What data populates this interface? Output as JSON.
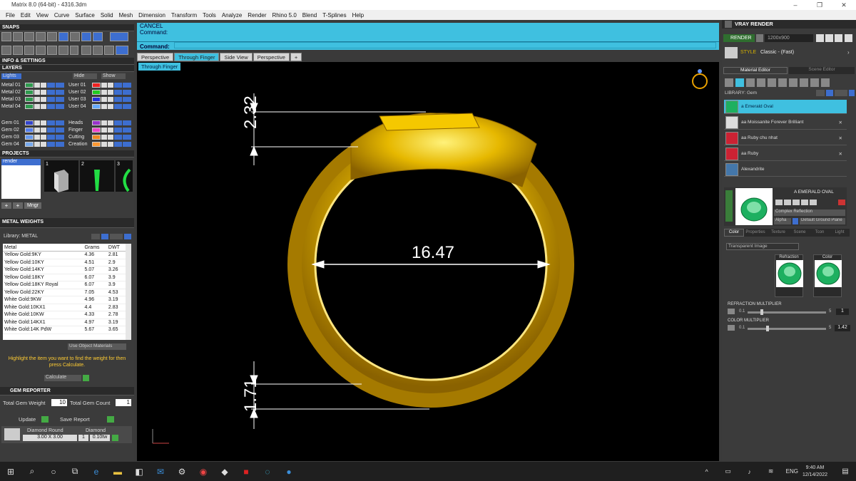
{
  "window": {
    "title": "Matrix 8.0 (64-bit) - 4316.3dm",
    "controls": [
      "–",
      "❐",
      "✕"
    ]
  },
  "menu": [
    "File",
    "Edit",
    "View",
    "Curve",
    "Surface",
    "Solid",
    "Mesh",
    "Dimension",
    "Transform",
    "Tools",
    "Analyze",
    "Render",
    "Rhino 5.0",
    "Blend",
    "T-Splines",
    "Help"
  ],
  "left": {
    "snaps": "SNAPS",
    "info": "INFO & SETTINGS",
    "layers_title": "LAYERS",
    "lights": "Lights",
    "hide": "Hide",
    "show": "Show",
    "layers_left": [
      {
        "name": "Metal 01",
        "color": "#2e9a4e"
      },
      {
        "name": "Metal 02",
        "color": "#2e9a4e"
      },
      {
        "name": "Metal 03",
        "color": "#2e9a4e"
      },
      {
        "name": "Metal 04",
        "color": "#2e9a4e"
      },
      {
        "name": "Gem 01",
        "color": "#3344cc"
      },
      {
        "name": "Gem 02",
        "color": "#5580ee"
      },
      {
        "name": "Gem 03",
        "color": "#6699ee"
      },
      {
        "name": "Gem 04",
        "color": "#77aaee"
      }
    ],
    "layers_right": [
      {
        "name": "User 01",
        "color": "#ee2222"
      },
      {
        "name": "User 02",
        "color": "#22cc22"
      },
      {
        "name": "User 03",
        "color": "#2233dd"
      },
      {
        "name": "User 04",
        "color": "#66aaff"
      },
      {
        "name": "Heads",
        "color": "#9933cc"
      },
      {
        "name": "Finger",
        "color": "#ee44cc"
      },
      {
        "name": "Cutting",
        "color": "#ee8822"
      },
      {
        "name": "Creation",
        "color": "#ff9933"
      }
    ],
    "projects": "PROJECTS",
    "project_name": "render",
    "thumb_numbers": [
      "1",
      "2",
      "3"
    ],
    "mngr": "Mngr",
    "metal_weights": "METAL WEIGHTS",
    "library": "Library: METAL",
    "columns": [
      "Metal",
      "Grams",
      "DWT"
    ],
    "metals": [
      [
        "Yellow Gold:9KY",
        "4.36",
        "2.81"
      ],
      [
        "Yellow Gold:10KY",
        "4.51",
        "2.9"
      ],
      [
        "Yellow Gold:14KY",
        "5.07",
        "3.26"
      ],
      [
        "Yellow Gold:18KY",
        "6.07",
        "3.9"
      ],
      [
        "Yellow Gold:18KY Royal",
        "6.07",
        "3.9"
      ],
      [
        "Yellow Gold:22KY",
        "7.05",
        "4.53"
      ],
      [
        "White Gold:9KW",
        "4.96",
        "3.19"
      ],
      [
        "White Gold:10KX1",
        "4.4",
        "2.83"
      ],
      [
        "White Gold:10KW",
        "4.33",
        "2.78"
      ],
      [
        "White Gold:14KX1",
        "4.97",
        "3.19"
      ],
      [
        "White Gold:14K PdW",
        "5.67",
        "3.65"
      ]
    ],
    "use_object_materials": "Use Object Materials",
    "hint": "Highlight the item you want to find the weight for then press Calculate.",
    "calculate": "Calculate",
    "gem_reporter": "GEM REPORTER",
    "total_weight_label": "Total Gem Weight",
    "total_weight": "10",
    "total_count_label": "Total Gem Count",
    "total_count": "1",
    "update": "Update",
    "save_report": "Save Report",
    "gem_shape": "Diamond Round",
    "gem_size": "3.00 X 3.00",
    "gem_material": "Diamond",
    "gem_qty": "1",
    "gem_ctw": "0.10tw"
  },
  "command": {
    "line1": "CANCEL",
    "line2": "Command:",
    "prompt": "Command:"
  },
  "tabs": [
    "Perspective",
    "Through Finger",
    "Side View",
    "Perspective"
  ],
  "active_tab": 1,
  "viewport_label": "Through Finger",
  "dims": {
    "top": "2.32",
    "middle": "16.47",
    "bottom": "1.71"
  },
  "ring_color": "#e0b000",
  "vray": {
    "title": "VRAY RENDER",
    "render": "RENDER",
    "resolution": "1200x900",
    "style_label": "STYLE",
    "style_value": "Classic - (Fast)",
    "material_editor": "Material Editor",
    "scene_editor": "Scene Editor",
    "library": "LIBRARY: Gem",
    "materials": [
      {
        "name": "a Emerald Oval",
        "color": "#1db060"
      },
      {
        "name": "aa Moissanite Forever Brilliant",
        "color": "#dddddd"
      },
      {
        "name": "aa Ruby chu nhat",
        "color": "#cc2233"
      },
      {
        "name": "aa Ruby",
        "color": "#cc2233"
      },
      {
        "name": "Alexandrite",
        "color": "#4477aa"
      }
    ],
    "preview_name": "A EMERALD OVAL",
    "preview_type": "Complex Reflection",
    "alpha": "Alpha",
    "ground": "Default Ground Plane",
    "subtabs": [
      "Color",
      "Properties",
      "Texture",
      "Scene",
      "Tcon",
      "Light"
    ],
    "mode": "Transparent Image",
    "refraction": "Refraction",
    "color": "Color",
    "refr_mult": "REFRACTION MULTIPLIER",
    "refr_min": "0.1",
    "refr_max": "5",
    "refr_val": "1",
    "color_mult": "COLOR MULTIPLIER",
    "color_min": "0.1",
    "color_max": "5",
    "color_val": "1.42"
  },
  "taskbar": {
    "lang": "ENG",
    "time": "9:40 AM",
    "date": "12/14/2022"
  }
}
